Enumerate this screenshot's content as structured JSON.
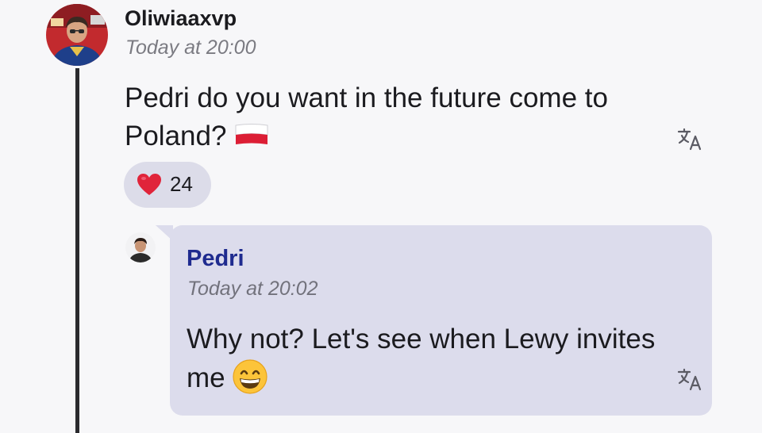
{
  "message": {
    "username": "Oliwiaaxvp",
    "timestamp": "Today at 20:00",
    "text": "Pedri do you want in the future come to Poland?",
    "inline_emoji": "poland-flag",
    "translate_icon": "translate-icon"
  },
  "reaction": {
    "emoji": "heart-icon",
    "count": "24"
  },
  "reply": {
    "username": "Pedri",
    "timestamp": "Today at 20:02",
    "text": "Why not? Let's see when Lewy invites me",
    "inline_emoji": "grinning-face",
    "translate_icon": "translate-icon"
  },
  "colors": {
    "background": "#f7f7f9",
    "reply_bubble": "#dcdcec",
    "reaction_pill": "#dcdce9",
    "reply_username": "#1f2b8f",
    "timestamp": "#7b7b82",
    "thread_line": "#2a2a2e"
  }
}
